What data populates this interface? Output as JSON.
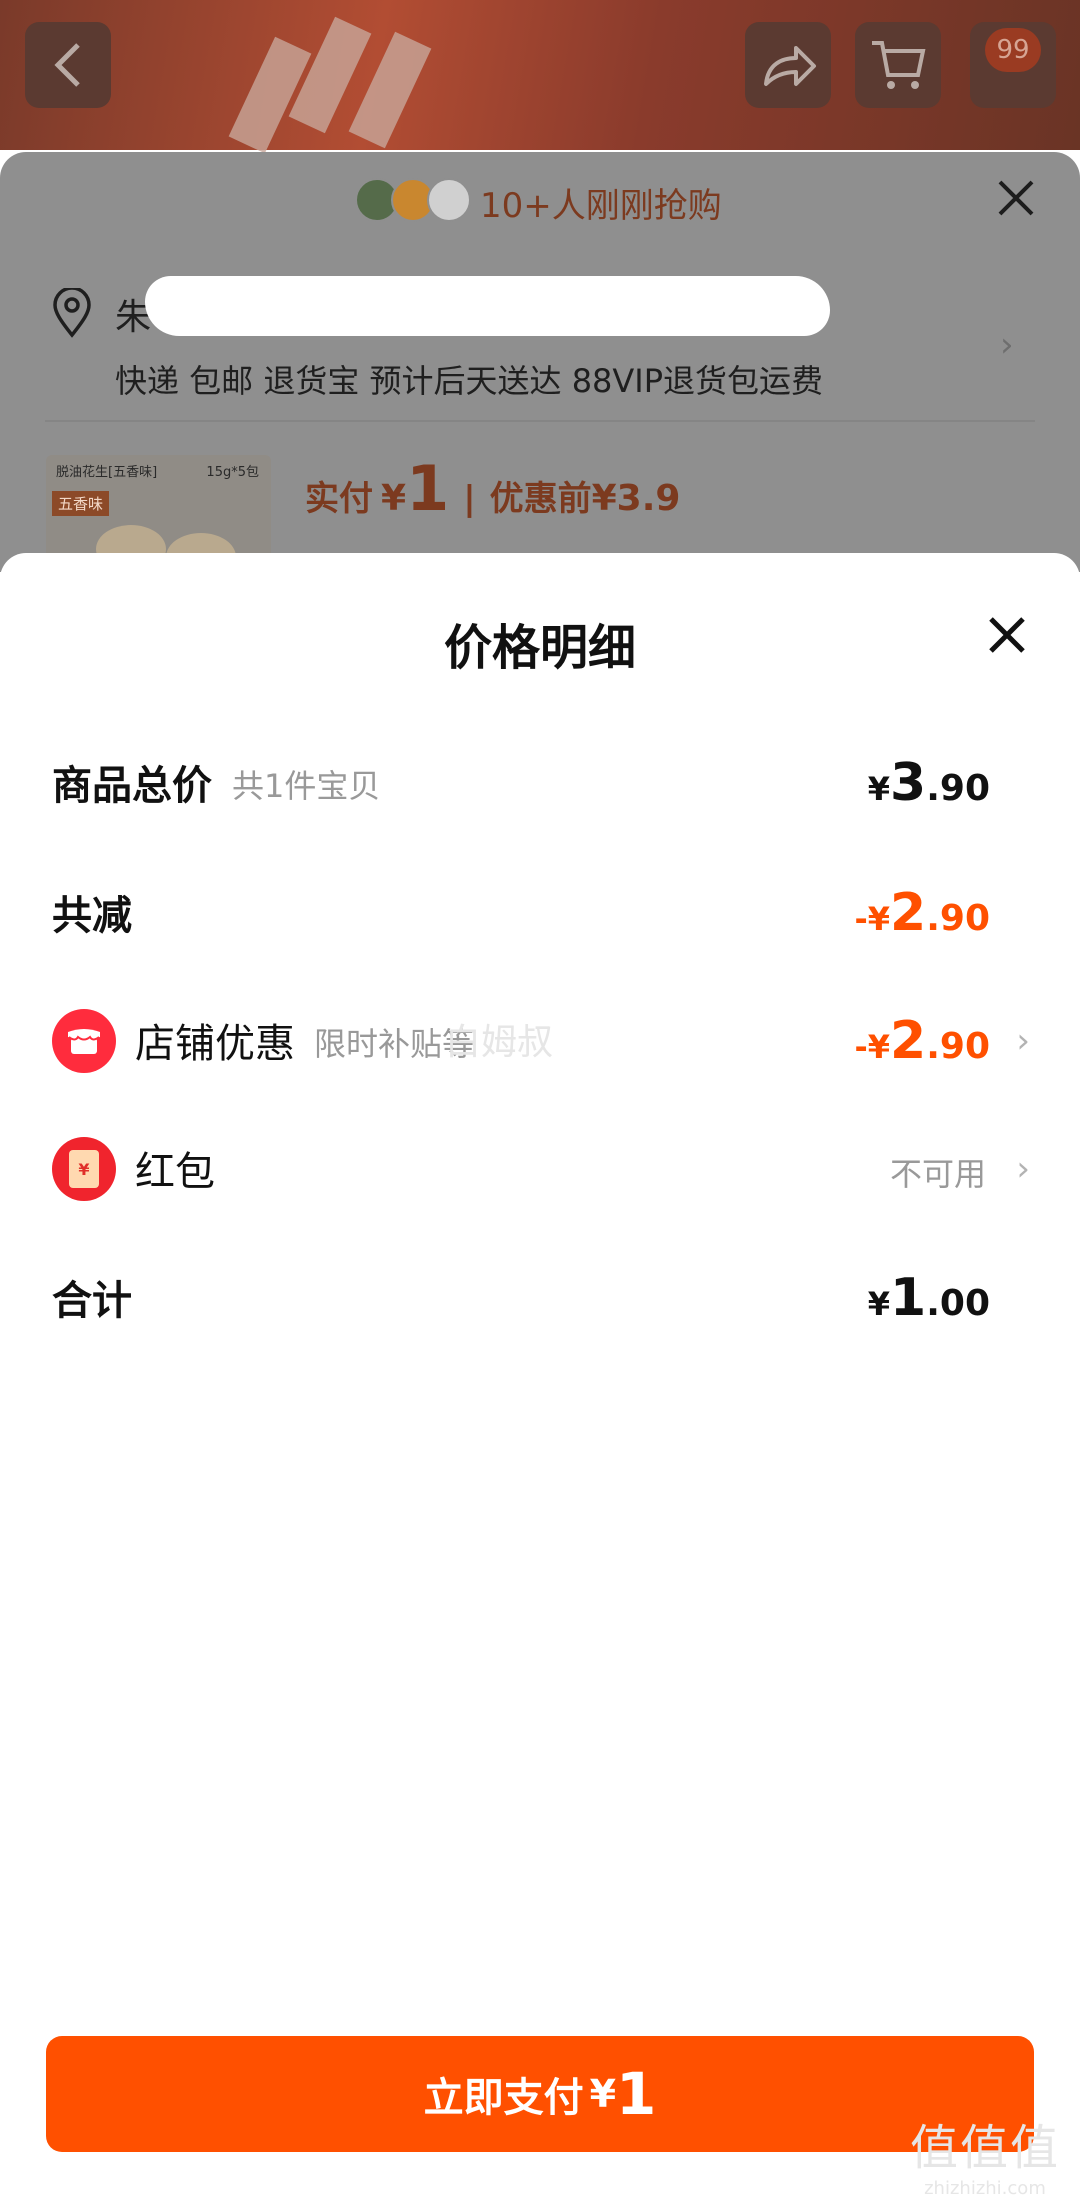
{
  "top_bar": {
    "cart_badge": "99"
  },
  "panel": {
    "buyers_text": "10+人刚刚抢购",
    "address_prefix": "朱",
    "delivery_line": "快递 包邮 退货宝 预计后天送达 88VIP退货包运费",
    "thumbnail": {
      "name": "脱油花生[五香味]",
      "spec": "15g*5包",
      "tag": "五香味"
    },
    "pay_label": "实付",
    "pay_currency": "¥",
    "pay_amount": "1",
    "before_label": "优惠前",
    "before_amount": "¥3.9"
  },
  "sheet": {
    "title": "价格明细",
    "rows": {
      "total": {
        "label": "商品总价",
        "sub": "共1件宝贝",
        "currency": "¥",
        "int": "3",
        "dec": ".90"
      },
      "discount": {
        "label": "共减",
        "currency": "-¥",
        "int": "2",
        "dec": ".90"
      },
      "shop": {
        "label": "店铺优惠",
        "sub": "限时补贴等",
        "currency": "-¥",
        "int": "2",
        "dec": ".90"
      },
      "redpacket": {
        "label": "红包",
        "status": "不可用"
      },
      "sum": {
        "label": "合计",
        "currency": "¥",
        "int": "1",
        "dec": ".00"
      }
    },
    "watermark": "白姆叔"
  },
  "pay_button": {
    "label": "立即支付",
    "currency": "¥",
    "amount": "1"
  },
  "site_watermark": {
    "logo": "值值值",
    "domain": "zhizhizhi.com"
  },
  "colors": {
    "accent": "#ff5000",
    "shop_icon": "#ff2c3d",
    "redpacket_icon": "#f0242d"
  }
}
